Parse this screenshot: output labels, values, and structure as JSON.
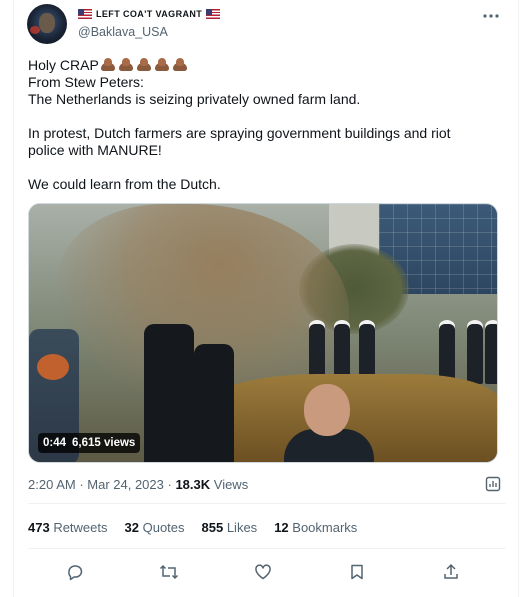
{
  "author": {
    "display_name": "LEFT COA'T VAGRANT",
    "handle": "@Baklava_USA",
    "flag_left": "us-flag",
    "flag_right": "us-flag"
  },
  "more_icon": "more-dots-icon",
  "tweet": {
    "lines": [
      "Holy CRAP",
      "From Stew Peters:",
      "The Netherlands is seizing privately owned farm land.",
      "",
      "In protest, Dutch farmers are spraying government buildings and riot",
      "police with MANURE!",
      "",
      "We could learn from the Dutch."
    ],
    "emoji": [
      "pile-of-poo",
      "pile-of-poo",
      "pile-of-poo",
      "pile-of-poo",
      "pile-of-poo"
    ]
  },
  "video": {
    "duration": "0:44",
    "views": "6,615 views"
  },
  "meta": {
    "time": "2:20 AM",
    "separator": " · ",
    "date": "Mar 24, 2023",
    "views_count": "18.3K",
    "views_label": " Views"
  },
  "stats": {
    "retweets_count": "473",
    "retweets_label": " Retweets",
    "quotes_count": "32",
    "quotes_label": " Quotes",
    "likes_count": "855",
    "likes_label": " Likes",
    "bookmarks_count": "12",
    "bookmarks_label": " Bookmarks"
  },
  "actions": [
    "reply-icon",
    "retweet-icon",
    "like-icon",
    "bookmark-icon",
    "share-icon"
  ],
  "colors": {
    "text": "#0f1419",
    "secondary": "#536471",
    "border": "#eff3f4"
  }
}
